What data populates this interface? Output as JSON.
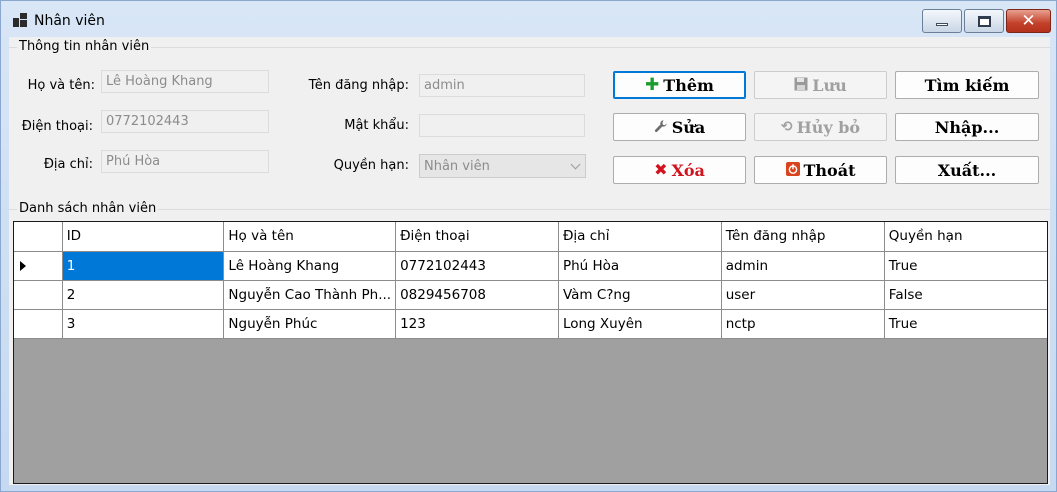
{
  "window": {
    "title": "Nhân viên",
    "controls": {
      "minimize_icon": "minimize-icon",
      "maximize_icon": "maximize-icon",
      "close_icon": "close-icon"
    }
  },
  "info_group": {
    "caption": "Thông tin nhân viên",
    "fields": {
      "name": {
        "label": "Họ và tên:",
        "value": "Lê Hoàng Khang"
      },
      "phone": {
        "label": "Điện thoại:",
        "value": "0772102443"
      },
      "address": {
        "label": "Địa chỉ:",
        "value": "Phú Hòa"
      },
      "username": {
        "label": "Tên đăng nhập:",
        "value": "admin"
      },
      "password": {
        "label": "Mật khẩu:",
        "value": ""
      },
      "role": {
        "label": "Quyền hạn:",
        "value": "Nhân viên"
      }
    }
  },
  "buttons": {
    "add": {
      "label": "Thêm",
      "icon": "plus-icon",
      "color": "#1a9c2f"
    },
    "save": {
      "label": "Lưu",
      "icon": "floppy-icon"
    },
    "search": {
      "label": "Tìm kiếm"
    },
    "edit": {
      "label": "Sửa",
      "icon": "wrench-icon"
    },
    "cancel": {
      "label": "Hủy bỏ",
      "icon": "undo-icon"
    },
    "import": {
      "label": "Nhập..."
    },
    "delete": {
      "label": "Xóa",
      "icon": "x-icon",
      "color": "#d4121e"
    },
    "exit": {
      "label": "Thoát",
      "icon": "power-icon"
    },
    "export": {
      "label": "Xuất..."
    }
  },
  "list_group": {
    "caption": "Danh sách nhân viên",
    "columns": [
      "ID",
      "Họ và tên",
      "Điện thoại",
      "Địa chỉ",
      "Tên đăng nhập",
      "Quyền hạn"
    ],
    "rows": [
      [
        "1",
        "Lê Hoàng Khang",
        "0772102443",
        "Phú Hòa",
        "admin",
        "True"
      ],
      [
        "2",
        "Nguyễn Cao Thành Ph...",
        "0829456708",
        "Vàm C?ng",
        "user",
        "False"
      ],
      [
        "3",
        "Nguyễn Phúc",
        "123",
        "Long Xuyên",
        "nctp",
        "True"
      ]
    ],
    "selected_row": 0,
    "selection_color": "#0078d7"
  }
}
